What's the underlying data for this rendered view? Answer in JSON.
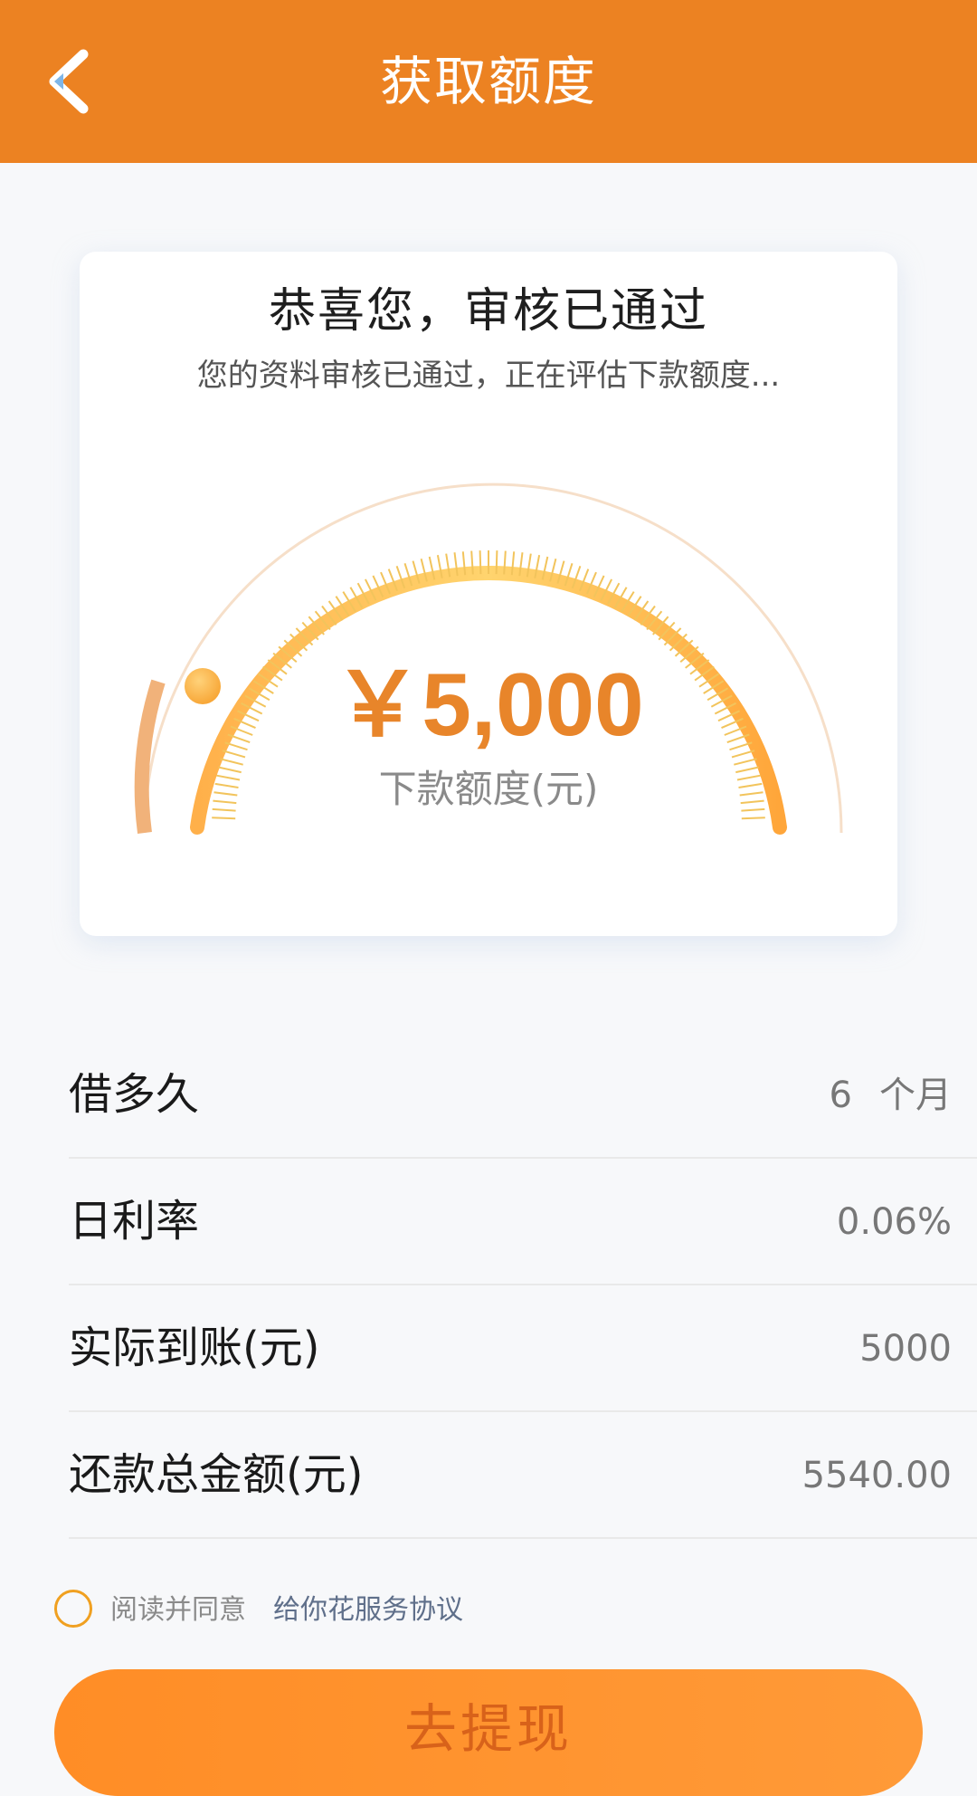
{
  "header": {
    "title": "获取额度",
    "back_icon": "chevron-left-icon"
  },
  "card": {
    "title": "恭喜您，审核已通过",
    "subtitle": "您的资料审核已通过，正在评估下款额度...",
    "amount": "￥5,000",
    "amount_label": "下款额度(元)"
  },
  "details": [
    {
      "label": "借多久",
      "value": "6",
      "unit": "个月"
    },
    {
      "label": "日利率",
      "value": "0.06%"
    },
    {
      "label": "实际到账(元)",
      "value": "5000"
    },
    {
      "label": "还款总金额(元)",
      "value": "5540.00"
    }
  ],
  "agreement": {
    "prefix": "阅读并同意",
    "link": "给你花服务协议",
    "checked": false
  },
  "button": {
    "label": "去提现"
  },
  "colors": {
    "accent": "#ec8222",
    "amount": "#e8852a",
    "gauge_light": "#ffd36e",
    "link": "#5f6f8a"
  }
}
